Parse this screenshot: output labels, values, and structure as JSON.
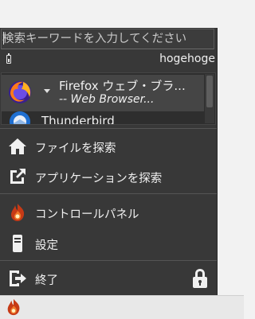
{
  "search": {
    "placeholder": "検索キーワードを入力してください"
  },
  "user": {
    "name": "hogehoge"
  },
  "apps": [
    {
      "name": "Firefox ウェブ・ブラ...",
      "description": "-- Web Browser..."
    },
    {
      "name": "Thunderbird"
    }
  ],
  "menu": {
    "find_files": "ファイルを探索",
    "find_apps": "アプリケーションを探索",
    "control_panel": "コントロールパネル",
    "settings": "設定",
    "quit": "終了"
  },
  "colors": {
    "menu_bg": "#383838",
    "taskbar_bg": "#e8e8e8",
    "text": "#f0f0f0"
  }
}
